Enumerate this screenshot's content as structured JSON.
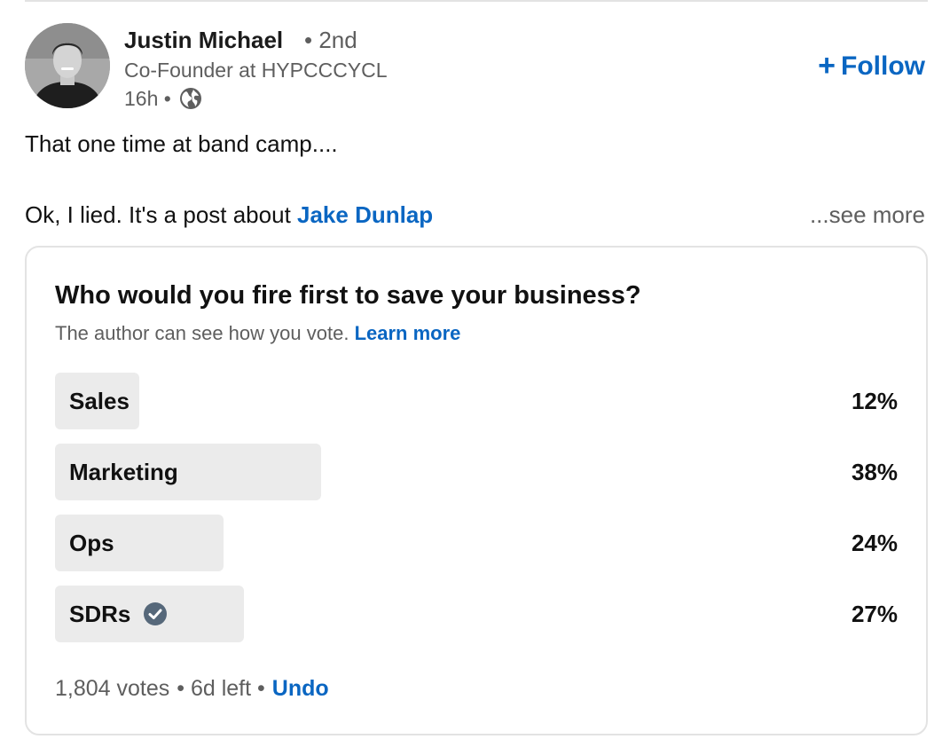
{
  "author": {
    "name": "Justin Michael",
    "degree": "• 2nd",
    "headline": "Co-Founder at HYPCCCYCL",
    "time": "16h •",
    "visibility_icon": "globe-icon"
  },
  "follow": {
    "label": "Follow",
    "icon": "+"
  },
  "post": {
    "line1": "That one time at band camp....",
    "line2_prefix": "Ok, I lied. It's a post about ",
    "mention": "Jake Dunlap",
    "see_more": "...see more"
  },
  "poll": {
    "question": "Who would you fire first to save your business?",
    "note": "The author can see how you vote.",
    "learn_more": "Learn more",
    "options": [
      {
        "label": "Sales",
        "percent_text": "12%",
        "percent": 12,
        "selected": false
      },
      {
        "label": "Marketing",
        "percent_text": "38%",
        "percent": 38,
        "selected": false
      },
      {
        "label": "Ops",
        "percent_text": "24%",
        "percent": 24,
        "selected": false
      },
      {
        "label": "SDRs",
        "percent_text": "27%",
        "percent": 27,
        "selected": true
      }
    ],
    "votes": "1,804 votes",
    "time_left": "• 6d left •",
    "undo": "Undo"
  },
  "colors": {
    "accent": "#0a66c2",
    "bar": "#ebebeb",
    "muted_text": "#5e5e5e",
    "check_fill": "#56687a"
  }
}
